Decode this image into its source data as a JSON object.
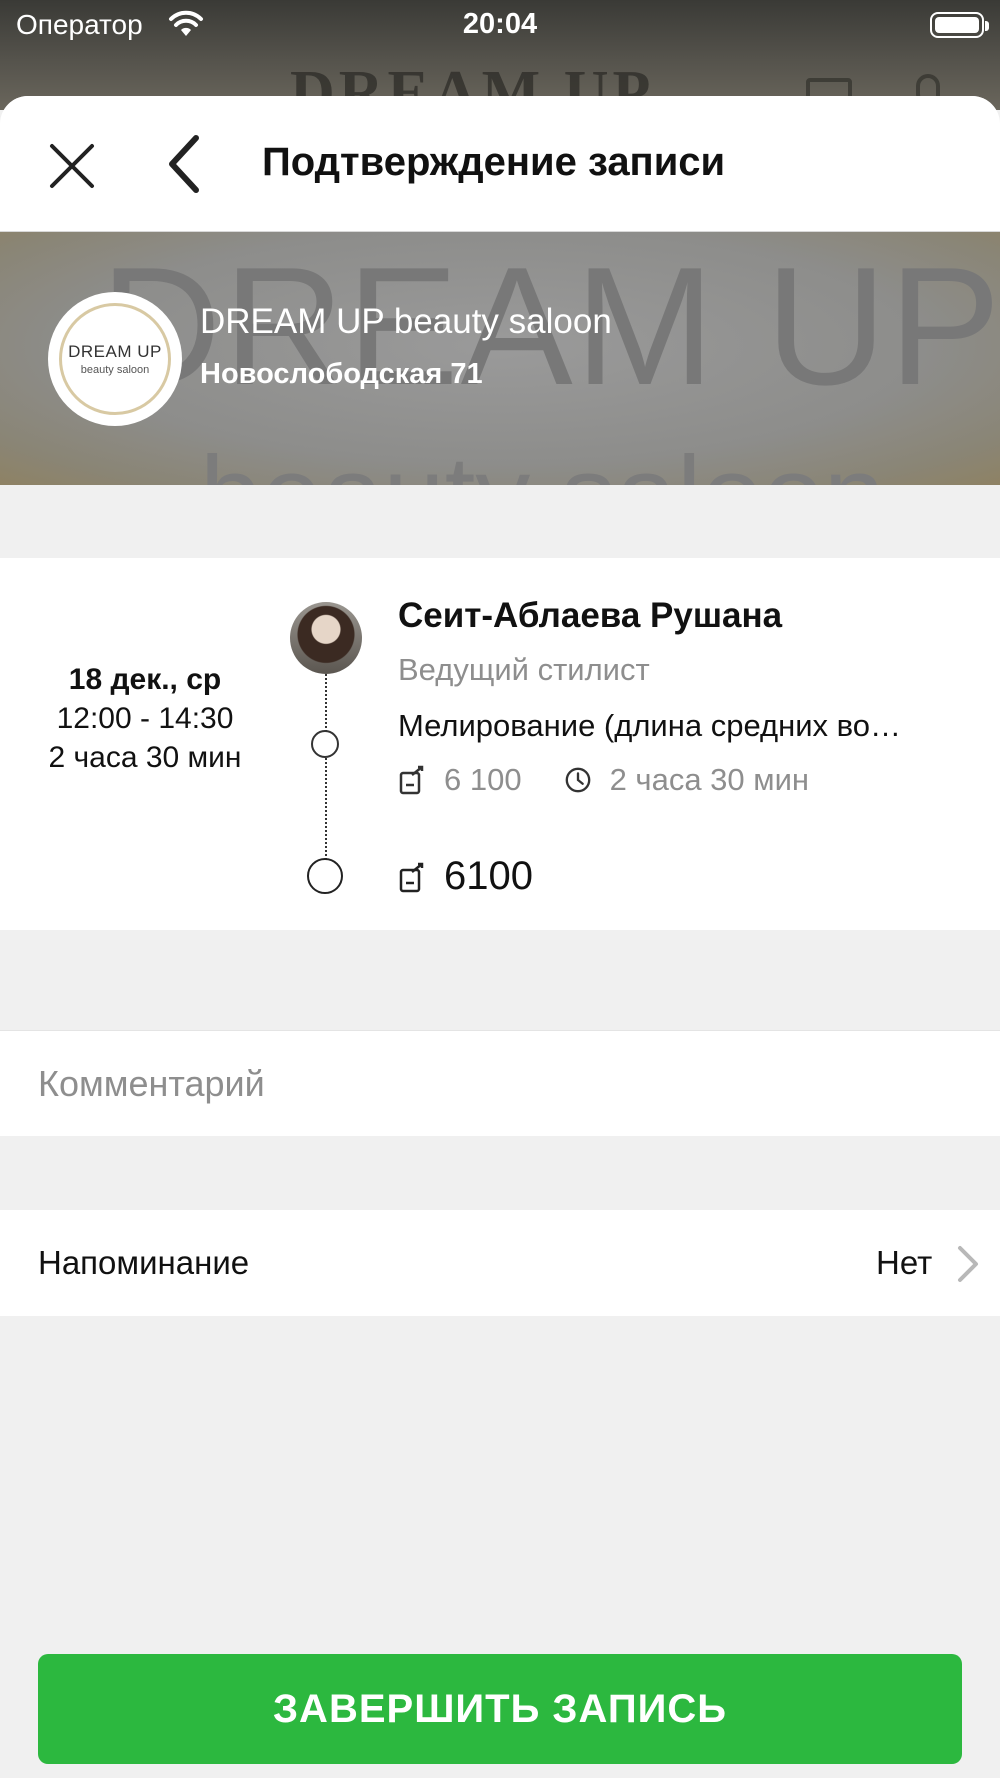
{
  "status_bar": {
    "operator": "Оператор",
    "time": "20:04"
  },
  "backdrop": {
    "title_fragment": "DREAM UP"
  },
  "nav": {
    "title": "Подтверждение записи",
    "close_icon": "close-icon",
    "back_icon": "chevron-left-icon"
  },
  "salon": {
    "logo_main": "DREAM UP",
    "logo_sub": "beauty saloon",
    "banner_text_main": "DREAM UP",
    "banner_text_sub": "beauty saloon",
    "name": "DREAM UP beauty saloon",
    "address": "Новослободская 71"
  },
  "booking": {
    "date": "18 дек., ср",
    "time_range": "12:00 - 14:30",
    "duration": "2 часа 30 мин",
    "master_name": "Сеит-Аблаева Рушана",
    "master_role": "Ведущий стилист",
    "service_name": "Мелирование (длина средних во…",
    "service_price": "6 100",
    "service_duration": "2 часа 30 мин",
    "total": "6100"
  },
  "comment": {
    "placeholder": "Комментарий"
  },
  "reminder": {
    "label": "Напоминание",
    "value": "Нет"
  },
  "submit": {
    "label": "ЗАВЕРШИТЬ ЗАПИСЬ"
  },
  "colors": {
    "accent": "#2cb83f",
    "muted_text": "#8e8e8e",
    "background": "#f0f0f0"
  }
}
